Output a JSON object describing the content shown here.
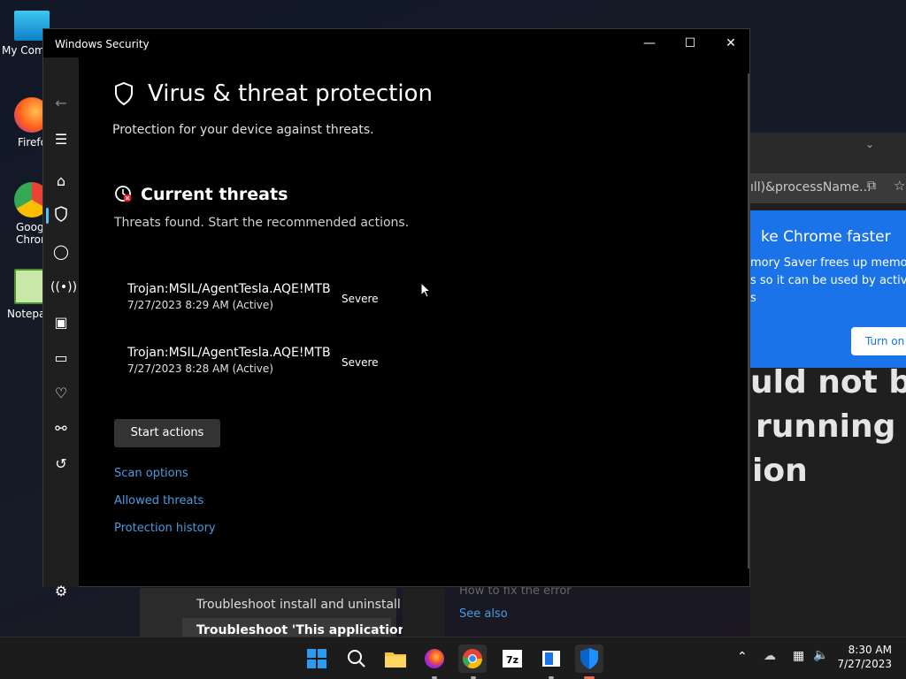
{
  "desktop": {
    "icons": [
      {
        "label": "My Com",
        "icon": "computer-icon"
      },
      {
        "label": "Firefo",
        "icon": "firefox-icon"
      },
      {
        "label": "Goog Chron",
        "icon": "chrome-icon"
      },
      {
        "label": "Notepa",
        "icon": "notepad-icon"
      }
    ]
  },
  "background_chrome": {
    "address_text": "ıll)&processName...",
    "popup_title": "ke Chrome faster",
    "popup_line1": "mory Saver frees up memory",
    "popup_line2": "s so it can be used by active t",
    "popup_line3": "s",
    "turn_on_label": "Turn on",
    "page_line1": "uld not be",
    "page_line2": "running a",
    "page_line3": "ion",
    "fix_error": "How to fix the error",
    "see_also": "See also",
    "help_item1": "Troubleshoot install and uninstall",
    "help_item2": "Troubleshoot 'This application"
  },
  "window": {
    "title": "Windows Security",
    "minimize_icon": "minimize-icon",
    "maximize_icon": "maximize-icon",
    "close_icon": "close-icon"
  },
  "nav": {
    "items": [
      "back-arrow-icon",
      "hamburger-icon",
      "home-icon",
      "shield-icon",
      "account-icon",
      "wireless-icon",
      "app-browser-icon",
      "device-icon",
      "health-icon",
      "family-icon",
      "history-icon",
      "settings-icon"
    ]
  },
  "main": {
    "title": "Virus & threat protection",
    "subtitle": "Protection for your device against threats.",
    "section_title": "Current threats",
    "section_subtitle": "Threats found. Start the recommended actions.",
    "threats": [
      {
        "name": "Trojan:MSIL/AgentTesla.AQE!MTB",
        "date": "7/27/2023 8:29 AM (Active)",
        "severity": "Severe"
      },
      {
        "name": "Trojan:MSIL/AgentTesla.AQE!MTB",
        "date": "7/27/2023 8:28 AM (Active)",
        "severity": "Severe"
      }
    ],
    "start_actions": "Start actions",
    "links": [
      "Scan options",
      "Allowed threats",
      "Protection history"
    ]
  },
  "taskbar": {
    "apps": [
      "windows-start-icon",
      "search-icon",
      "file-explorer-icon",
      "firefox-icon",
      "chrome-icon",
      "7zip-icon",
      "notepad-app-icon",
      "windows-security-icon"
    ],
    "time": "8:30 AM",
    "date": "7/27/2023",
    "tray_icons": [
      "chevron-up-icon",
      "cloud-icon",
      "network-icon",
      "volume-icon"
    ]
  },
  "colors": {
    "accent": "#4cc2ff",
    "link": "#4c9bdf",
    "chrome_blue": "#1a73e8"
  }
}
